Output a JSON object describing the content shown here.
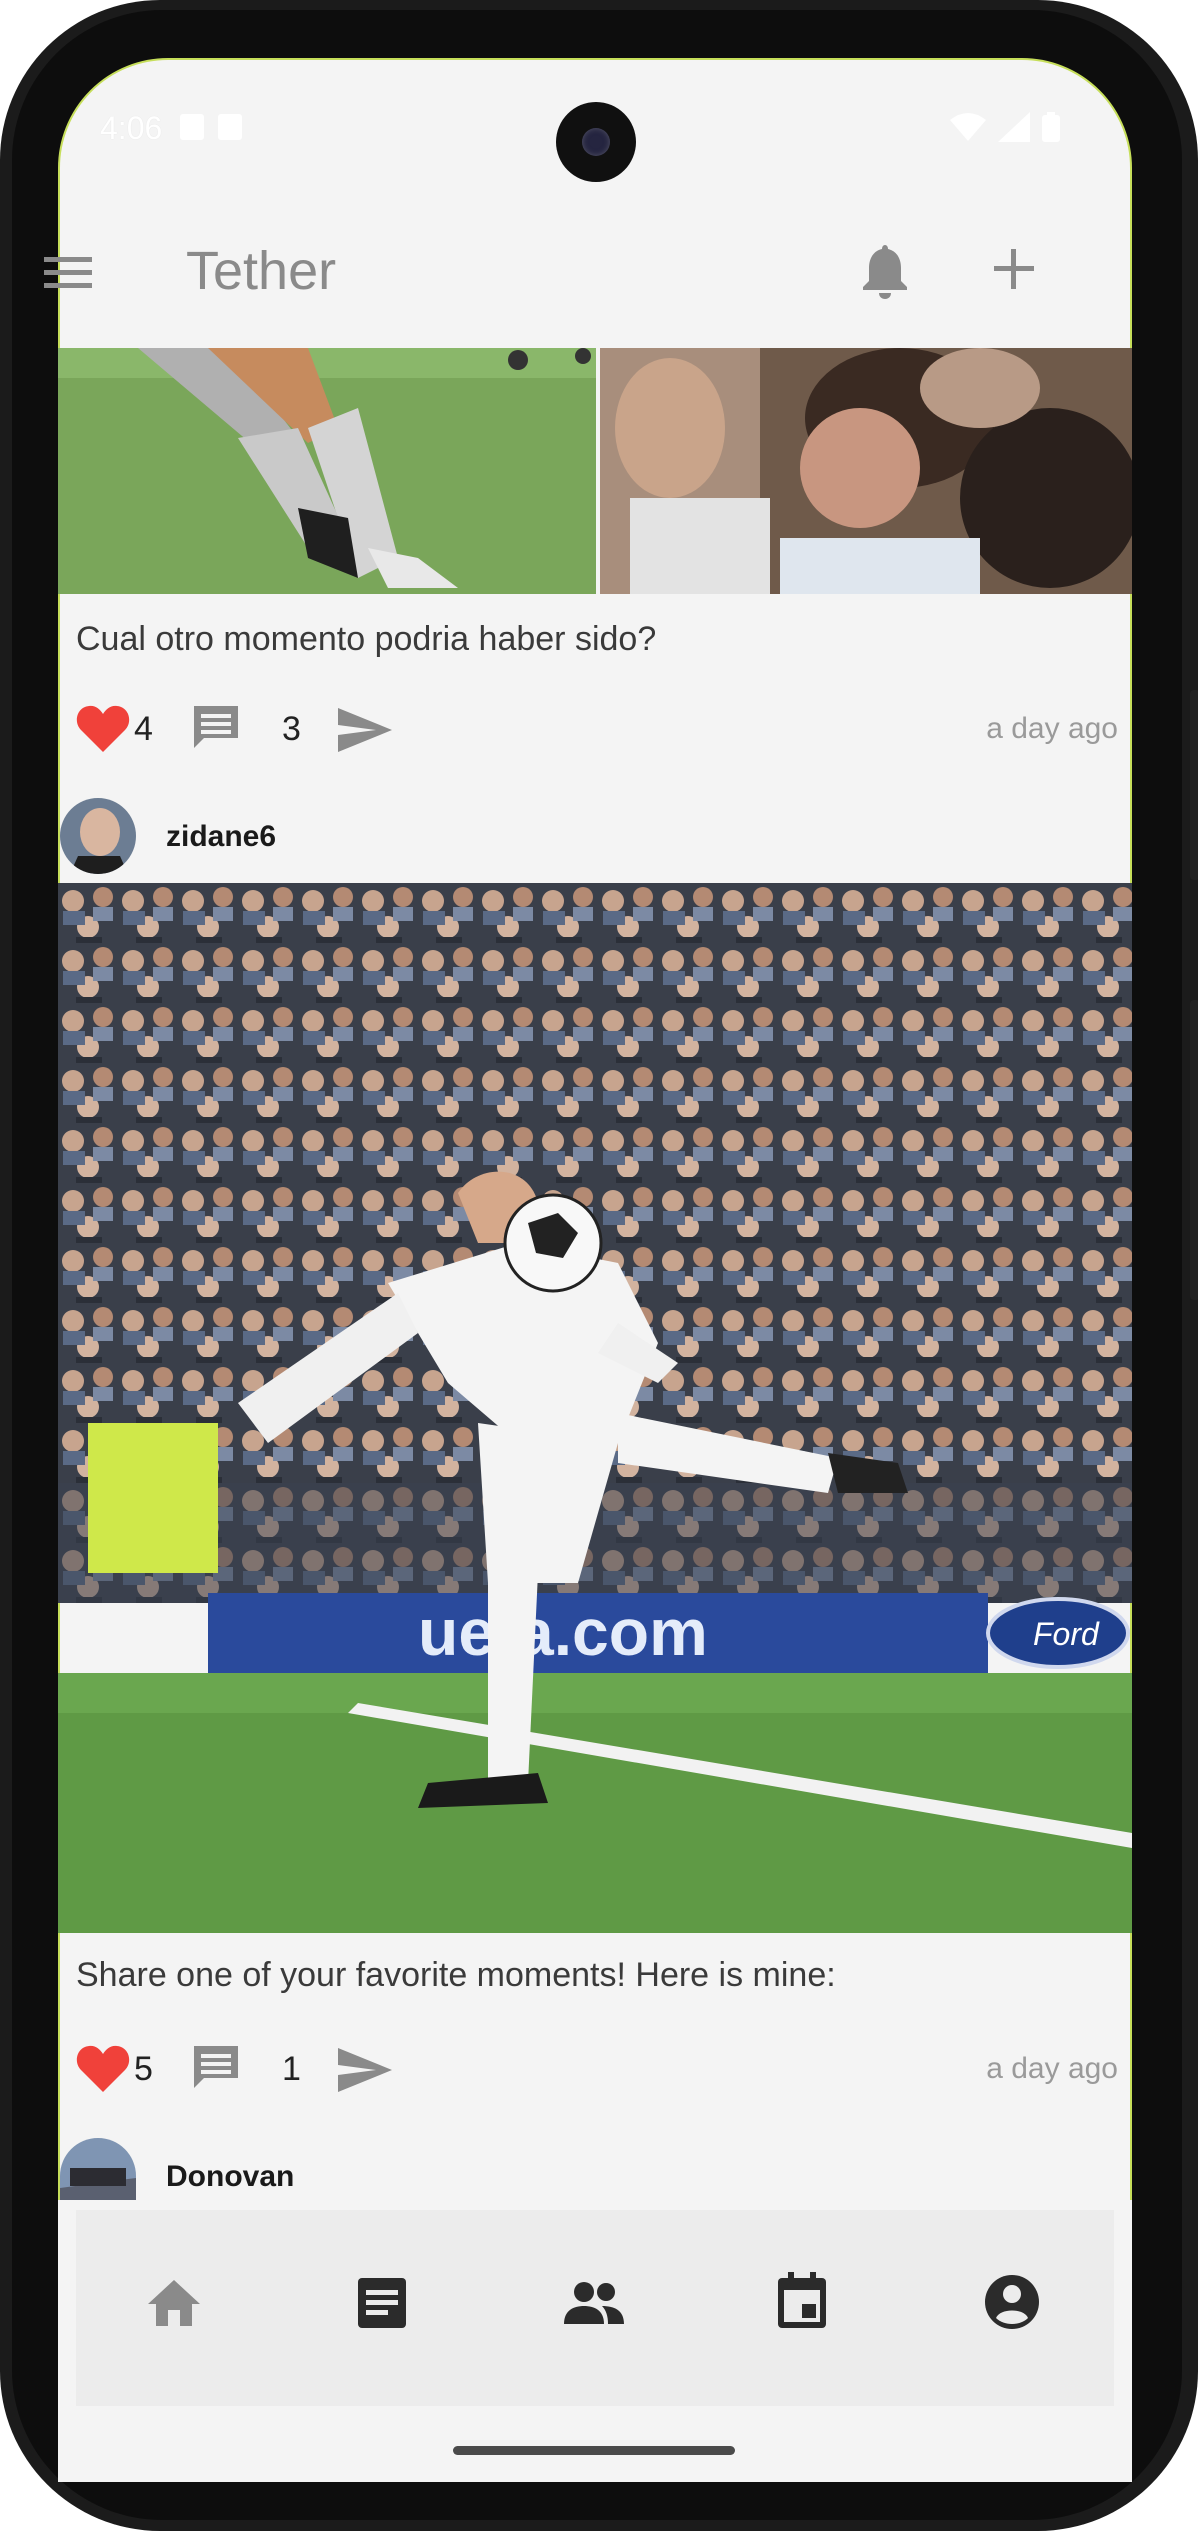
{
  "status_bar": {
    "time": "4:06"
  },
  "app_bar": {
    "title": "Tether"
  },
  "posts": [
    {
      "caption": "Cual otro momento podria haber sido?",
      "likes": "4",
      "comments": "3",
      "time_ago": "a day ago"
    },
    {
      "username": "zidane6",
      "caption": "Share one of your favorite moments! Here is mine:",
      "likes": "5",
      "comments": "1",
      "time_ago": "a day ago"
    },
    {
      "username": "Donovan"
    }
  ],
  "photo_texts": {
    "banner": "uefa.com",
    "sponsor": "Ford"
  },
  "bottom_nav": {
    "items": [
      "home",
      "feed",
      "people",
      "calendar",
      "profile"
    ],
    "selected": "feed"
  },
  "colors": {
    "like_red": "#f0413a",
    "icon_gray": "#888888",
    "accent_border": "#c6de5a"
  }
}
